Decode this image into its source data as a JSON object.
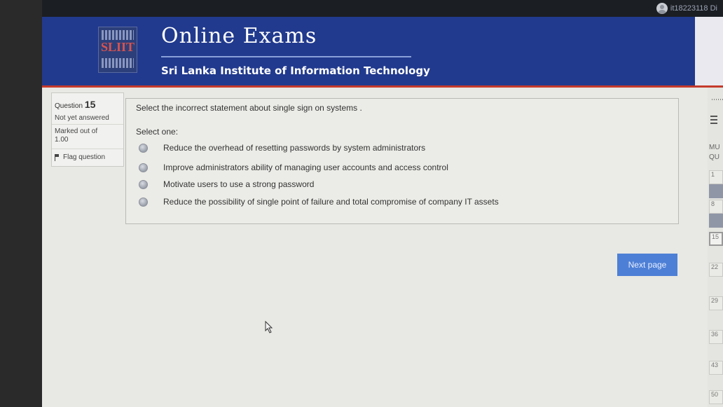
{
  "user": {
    "id": "it18223118 Di"
  },
  "header": {
    "logo_text": "SLIIT",
    "title": "Online Exams",
    "subtitle": "Sri Lanka Institute of Information Technology"
  },
  "question_info": {
    "label": "Question",
    "number": "15",
    "state": "Not yet answered",
    "marked": "Marked out of 1.00",
    "flag_label": "Flag question"
  },
  "question": {
    "text": "Select the incorrect statement about single sign on systems .",
    "prompt": "Select one:",
    "options": [
      "Reduce the overhead of resetting passwords by system administrators",
      "Improve administrators ability of managing user accounts and access control",
      "Motivate users to use a strong password",
      "Reduce the possibility of single point of failure and total compromise of company IT assets"
    ]
  },
  "next_button": "Next page",
  "nav": {
    "heading_1": "MU",
    "heading_2": "QU",
    "boxes": [
      "1",
      "8",
      "15",
      "22",
      "29",
      "36",
      "43",
      "50"
    ]
  }
}
